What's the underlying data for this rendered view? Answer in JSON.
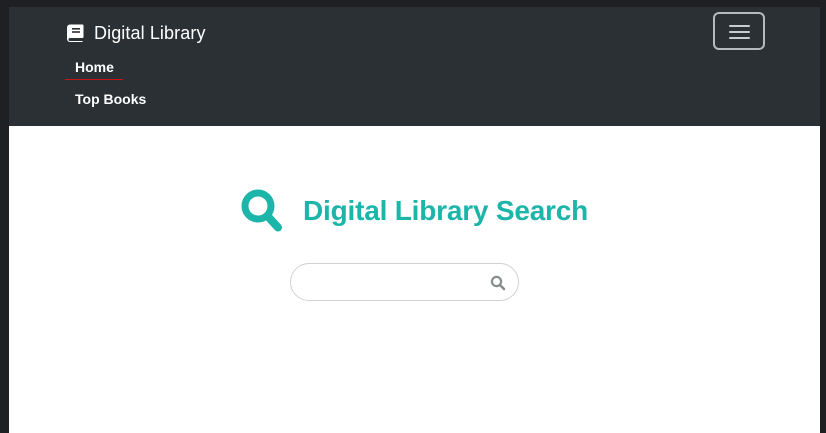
{
  "navbar": {
    "brand": {
      "icon": "book-icon",
      "text": "Digital Library"
    },
    "toggler_icon": "hamburger-menu-icon",
    "items": [
      {
        "label": "Home",
        "active": true
      },
      {
        "label": "Top Books",
        "active": false
      }
    ]
  },
  "main": {
    "icon": "search-icon",
    "title": "Digital Library Search",
    "search": {
      "value": "",
      "button_icon": "search-icon"
    }
  },
  "colors": {
    "navbar_bg": "#2b3035",
    "accent": "#1bb5a9",
    "active_underline": "#c9141b",
    "page_bg": "#ffffff"
  }
}
